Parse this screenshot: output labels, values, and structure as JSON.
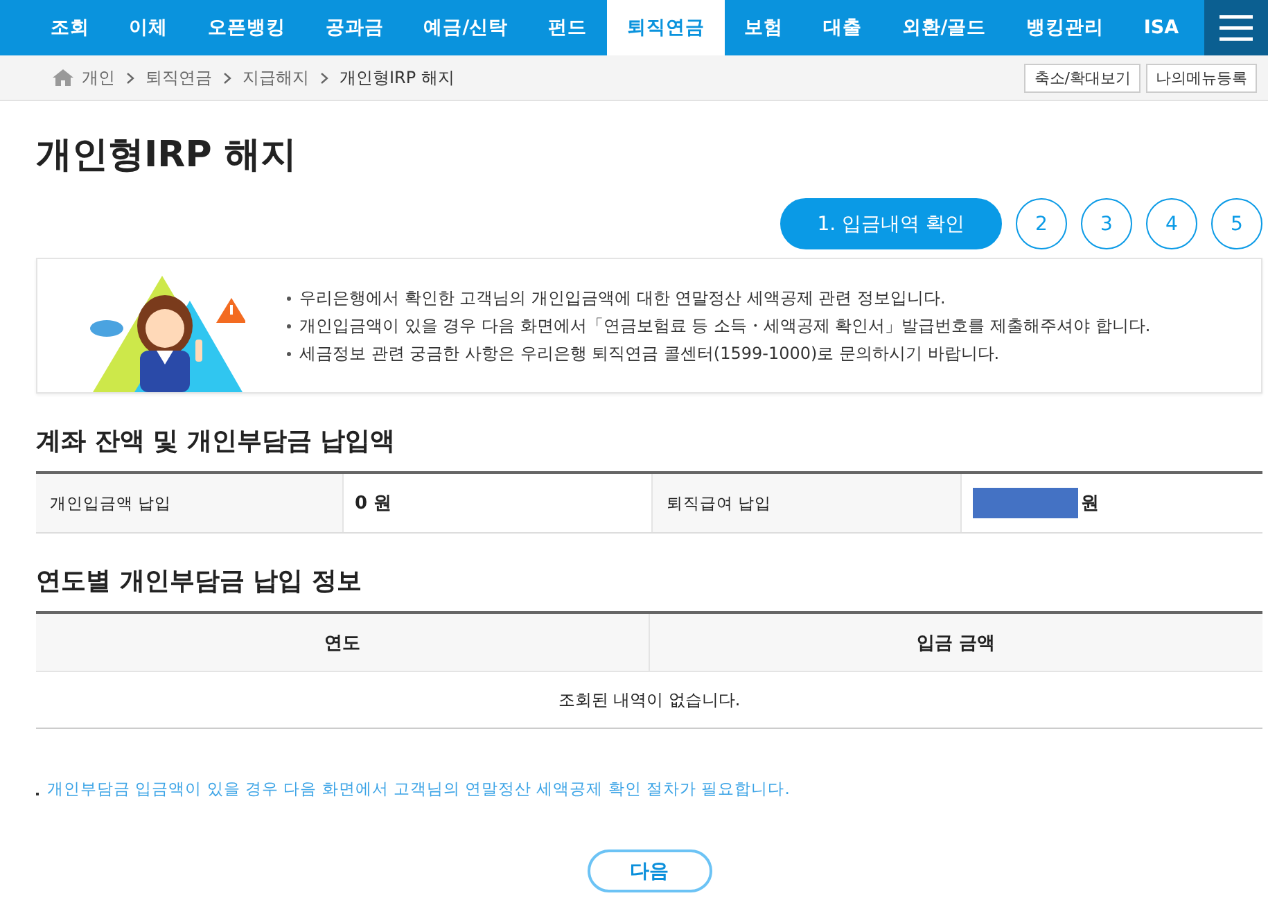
{
  "nav": {
    "tabs": [
      {
        "label": "조회",
        "selected": false
      },
      {
        "label": "이체",
        "selected": false
      },
      {
        "label": "오픈뱅킹",
        "selected": false
      },
      {
        "label": "공과금",
        "selected": false
      },
      {
        "label": "예금/신탁",
        "selected": false
      },
      {
        "label": "펀드",
        "selected": false
      },
      {
        "label": "퇴직연금",
        "selected": true
      },
      {
        "label": "보험",
        "selected": false
      },
      {
        "label": "대출",
        "selected": false
      },
      {
        "label": "외환/골드",
        "selected": false
      },
      {
        "label": "뱅킹관리",
        "selected": false
      },
      {
        "label": "ISA",
        "selected": false
      }
    ]
  },
  "breadcrumb": {
    "items": [
      "개인",
      "퇴직연금",
      "지급해지",
      "개인형IRP 해지"
    ],
    "buttons": [
      "축소/확대보기",
      "나의메뉴등록"
    ]
  },
  "page_title": "개인형IRP 해지",
  "steps": [
    {
      "label": "1. 입금내역 확인",
      "selected": true
    },
    {
      "label": "2",
      "selected": false
    },
    {
      "label": "3",
      "selected": false
    },
    {
      "label": "4",
      "selected": false
    },
    {
      "label": "5",
      "selected": false
    }
  ],
  "notice": {
    "lines": [
      "우리은행에서 확인한 고객님의 개인입금액에 대한 연말정산 세액공제 관련 정보입니다.",
      "개인입금액이 있을 경우 다음 화면에서「연금보험료 등 소득・세액공제 확인서」발급번호를 제출해주셔야 합니다.",
      "세금정보 관련 궁금한 사항은 우리은행 퇴직연금 콜센터(1599-1000)로 문의하시기 바랍니다."
    ]
  },
  "balance": {
    "title": "계좌 잔액 및 개인부담금 납입액",
    "fields": [
      {
        "label": "개인입금액 납입",
        "value": "0 원",
        "masked": false
      },
      {
        "label": "퇴직급여 납입",
        "value": "원",
        "masked": true
      }
    ]
  },
  "yearly": {
    "title": "연도별 개인부담금 납입 정보",
    "columns": [
      "연도",
      "입금 금액"
    ],
    "empty_message": "조회된 내역이 없습니다."
  },
  "footnote": "개인부담금 입금액이 있을 경우 다음 화면에서 고객님의 연말정산 세액공제 확인 절차가 필요합니다.",
  "next_button": "다음"
}
